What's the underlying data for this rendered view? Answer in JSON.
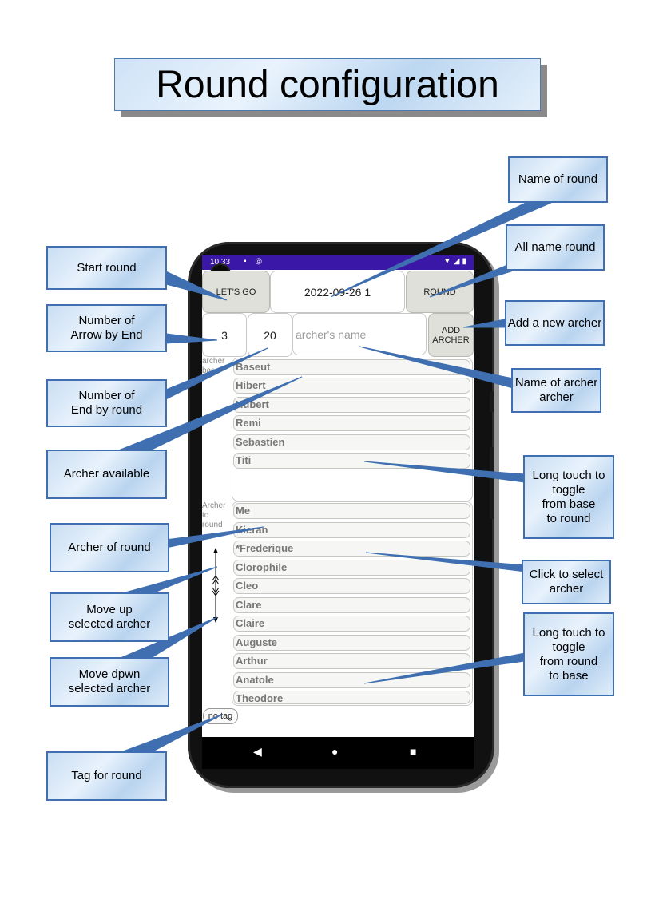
{
  "title": "Round configuration",
  "status_bar": {
    "time": "10:33"
  },
  "toolbar": {
    "lets_go": "LET'S GO",
    "round_name": "2022-09-26 1",
    "round_button": "ROUND",
    "arrows_per_end": "3",
    "ends_per_round": "20",
    "archer_name_placeholder": "archer's name",
    "add_archer": "ADD\nARCHER"
  },
  "labels": {
    "archer_base": "archer\nbase",
    "archer_to_round": "Archer\nto\nround"
  },
  "base_archers": [
    "Baseut",
    "Hibert",
    "Hubert",
    "Remi",
    "Sebastien",
    "Titi"
  ],
  "round_archers": [
    "Me",
    "Kieran",
    "*Frederique",
    "Clorophile",
    "Cleo",
    "Clare",
    "Claire",
    "Auguste",
    "Arthur",
    "Anatole",
    "Theodore"
  ],
  "tag_button": "no tag",
  "callouts": {
    "start_round": "Start round",
    "arrows_by_end": "Number of\nArrow by End",
    "end_by_round": "Number of\nEnd by round",
    "archer_available": "Archer available",
    "archer_of_round": "Archer of round",
    "move_up": "Move up\nselected archer",
    "move_down": "Move dpwn\nselected archer",
    "tag_for_round": "Tag for round",
    "name_of_round": "Name of round",
    "all_name_round": "All name round",
    "add_new_archer": "Add a new archer",
    "name_of_archer": "Name of archer\narcher",
    "toggle_to_round": "Long touch to\ntoggle\nfrom base\nto round",
    "click_select": "Click to select\narcher",
    "toggle_to_base": "Long touch to\ntoggle\nfrom round\nto base"
  },
  "colors": {
    "callout_border": "#3f6fb0",
    "status_bar": "#3b17a8"
  }
}
